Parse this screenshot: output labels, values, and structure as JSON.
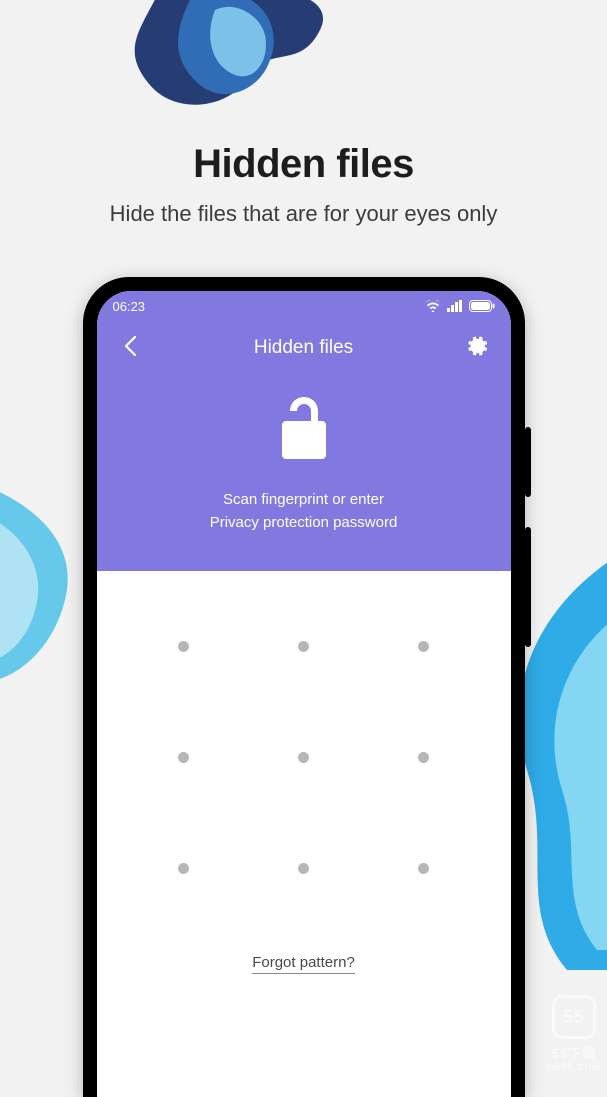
{
  "promo": {
    "title": "Hidden files",
    "subtitle": "Hide the files that are for your eyes only"
  },
  "status_bar": {
    "time": "06:23"
  },
  "app_header": {
    "title": "Hidden files",
    "instruction_line1": "Scan fingerprint or enter",
    "instruction_line2": "Privacy protection password"
  },
  "actions": {
    "forgot_pattern": "Forgot pattern?"
  },
  "watermark": {
    "box": "55",
    "line1": "55下载",
    "line2": "BE55.COM"
  },
  "colors": {
    "accent": "#8179e0",
    "page_bg": "#f2f2f2"
  }
}
